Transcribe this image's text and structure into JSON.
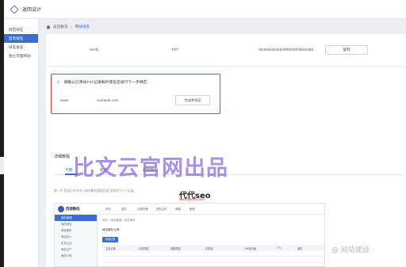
{
  "app": {
    "title": "返回设计"
  },
  "sidebar": {
    "items": [
      {
        "label": "绑定域名",
        "active": false
      },
      {
        "label": "自有域名",
        "active": true
      },
      {
        "label": "域名备案",
        "active": false
      },
      {
        "label": "独立页面网站",
        "active": false
      }
    ]
  },
  "breadcrumb": {
    "home": "返回概况",
    "current": "网站域名"
  },
  "dns_record": {
    "host": "verify",
    "type": "TXT",
    "value": "2b492a1ba1b09f9402fc5b4a3dd",
    "button": "复制"
  },
  "verification": {
    "step_number": "2.",
    "instruction": "请确认已添加TXT记录解析域名后进行下一步绑定:",
    "prefix": "www.",
    "domain": "example.com",
    "verify_button": "完成并验证"
  },
  "tutorial": {
    "title": "详细教程",
    "tabs": [
      {
        "label": "万网",
        "active": true
      },
      {
        "label": "新网",
        "active": false
      },
      {
        "label": "西部数码",
        "active": false
      }
    ],
    "hint": "第一步:登录后台并进入域名解析管理页面,添加如下TXT记录。"
  },
  "watermark": {
    "big": "比文云官网出品",
    "seo": "代代seo",
    "url": "www.ddseo.com",
    "corner": "@ 网站建设"
  },
  "embedded_shot": {
    "brand": "西部数码",
    "nav": [
      "首页",
      "域名",
      "云服务器",
      "虚拟主机",
      "邮箱",
      "备案"
    ],
    "sidebar": [
      "域名管理",
      "我的域名",
      "域名解析",
      "域名转入",
      "实名认证",
      "域名过户",
      "我的订单"
    ],
    "crumb": "首页 > 域名管理 > 域名解析",
    "section": "域名解析记录",
    "add_button": "添加记录",
    "columns": [
      "主机记录",
      "记录类型",
      "线路类型",
      "记录值",
      "MX优先级",
      "TTL",
      "操作"
    ]
  },
  "colors": {
    "accent": "#3d6bd4",
    "highlight_border": "#e23c3c",
    "watermark": "#8566d6"
  }
}
